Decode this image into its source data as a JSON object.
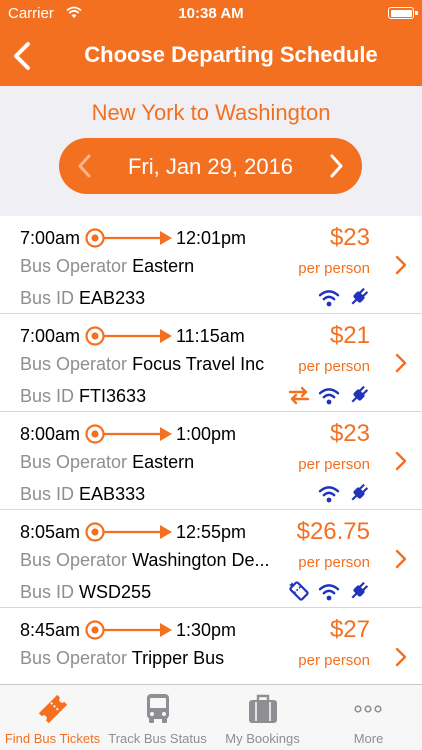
{
  "status_bar": {
    "carrier": "Carrier",
    "time": "10:38 AM"
  },
  "header": {
    "title": "Choose Departing Schedule"
  },
  "route": {
    "title": "New York to Washington",
    "date": "Fri, Jan 29, 2016"
  },
  "labels": {
    "bus_operator": "Bus Operator",
    "bus_id": "Bus ID",
    "per_person": "per person"
  },
  "colors": {
    "accent": "#f37021",
    "icon_blue": "#2233bb",
    "background": "#efeff4"
  },
  "trips": [
    {
      "depart": "7:00am",
      "arrive": "12:01pm",
      "price": "$23",
      "operator": "Eastern",
      "bus_id": "EAB233",
      "amenities": [
        "wifi-icon",
        "power-plug-icon"
      ]
    },
    {
      "depart": "7:00am",
      "arrive": "11:15am",
      "price": "$21",
      "operator": "Focus Travel Inc",
      "bus_id": "FTI3633",
      "amenities": [
        "transfer-icon",
        "wifi-icon",
        "power-plug-icon"
      ]
    },
    {
      "depart": "8:00am",
      "arrive": "1:00pm",
      "price": "$23",
      "operator": "Eastern",
      "bus_id": "EAB333",
      "amenities": [
        "wifi-icon",
        "power-plug-icon"
      ]
    },
    {
      "depart": "8:05am",
      "arrive": "12:55pm",
      "price": "$26.75",
      "operator": "Washington De...",
      "bus_id": "WSD255",
      "amenities": [
        "ticket-icon",
        "wifi-icon",
        "power-plug-icon"
      ]
    },
    {
      "depart": "8:45am",
      "arrive": "1:30pm",
      "price": "$27",
      "operator": "Tripper Bus",
      "bus_id": "",
      "amenities": []
    }
  ],
  "tabs": [
    {
      "label": "Find Bus Tickets",
      "icon": "ticket-icon",
      "active": true
    },
    {
      "label": "Track Bus Status",
      "icon": "bus-icon",
      "active": false
    },
    {
      "label": "My Bookings",
      "icon": "suitcase-icon",
      "active": false
    },
    {
      "label": "More",
      "icon": "more-dots-icon",
      "active": false
    }
  ]
}
